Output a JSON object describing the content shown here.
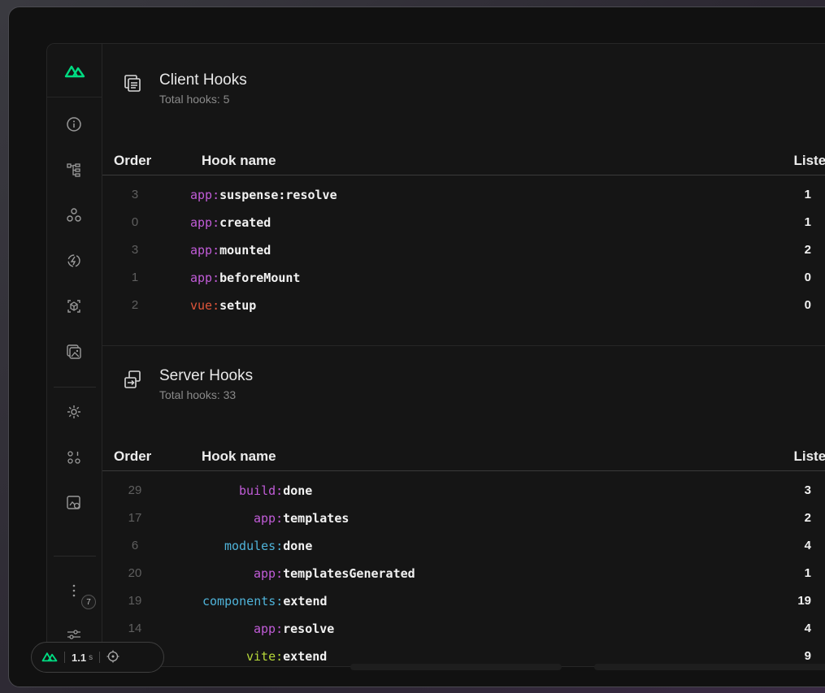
{
  "colors": {
    "nuxt_green": "#00dc82",
    "prefix_app": "#c15cd8",
    "prefix_vue": "#e0553a",
    "prefix_modules": "#4fb3d9",
    "prefix_vite": "#b7d93a"
  },
  "sidebar": {
    "logo": "nuxt-logo-icon",
    "items": [
      {
        "icon": "info-icon"
      },
      {
        "icon": "component-tree-icon"
      },
      {
        "icon": "modules-icon"
      },
      {
        "icon": "hooks-icon"
      },
      {
        "icon": "3d-box-icon"
      },
      {
        "icon": "image-icon"
      },
      {
        "icon": "settings-icon"
      },
      {
        "icon": "dots-grid-icon"
      },
      {
        "icon": "gallery-icon"
      },
      {
        "icon": "more-icon"
      },
      {
        "icon": "sliders-icon"
      }
    ],
    "more_badge": "7"
  },
  "client": {
    "title": "Client Hooks",
    "subtitle": "Total hooks: 5",
    "headers": {
      "order": "Order",
      "name": "Hook name",
      "listeners": "Listene"
    },
    "rows": [
      {
        "order": "3",
        "prefix": "app:",
        "name": "suspense:resolve",
        "listeners": "1",
        "color": "app"
      },
      {
        "order": "0",
        "prefix": "app:",
        "name": "created",
        "listeners": "1",
        "color": "app"
      },
      {
        "order": "3",
        "prefix": "app:",
        "name": "mounted",
        "listeners": "2",
        "color": "app"
      },
      {
        "order": "1",
        "prefix": "app:",
        "name": "beforeMount",
        "listeners": "0",
        "color": "app"
      },
      {
        "order": "2",
        "prefix": "vue:",
        "name": "setup",
        "listeners": "0",
        "color": "vue"
      }
    ]
  },
  "server": {
    "title": "Server Hooks",
    "subtitle": "Total hooks: 33",
    "headers": {
      "order": "Order",
      "name": "Hook name",
      "listeners": "Listene"
    },
    "rows": [
      {
        "order": "29",
        "prefix": "build:",
        "name": "done",
        "listeners": "3",
        "color": "app"
      },
      {
        "order": "17",
        "prefix": "app:",
        "name": "templates",
        "listeners": "2",
        "color": "app"
      },
      {
        "order": "6",
        "prefix": "modules:",
        "name": "done",
        "listeners": "4",
        "color": "modules"
      },
      {
        "order": "20",
        "prefix": "app:",
        "name": "templatesGenerated",
        "listeners": "1",
        "color": "app"
      },
      {
        "order": "19",
        "prefix": "components:",
        "name": "extend",
        "listeners": "19",
        "color": "modules"
      },
      {
        "order": "14",
        "prefix": "app:",
        "name": "resolve",
        "listeners": "4",
        "color": "app"
      },
      {
        "order": "",
        "prefix": "vite:",
        "name": "extend",
        "listeners": "9",
        "color": "vite"
      }
    ]
  },
  "float_bar": {
    "time_value": "1.1",
    "time_unit": "s"
  }
}
